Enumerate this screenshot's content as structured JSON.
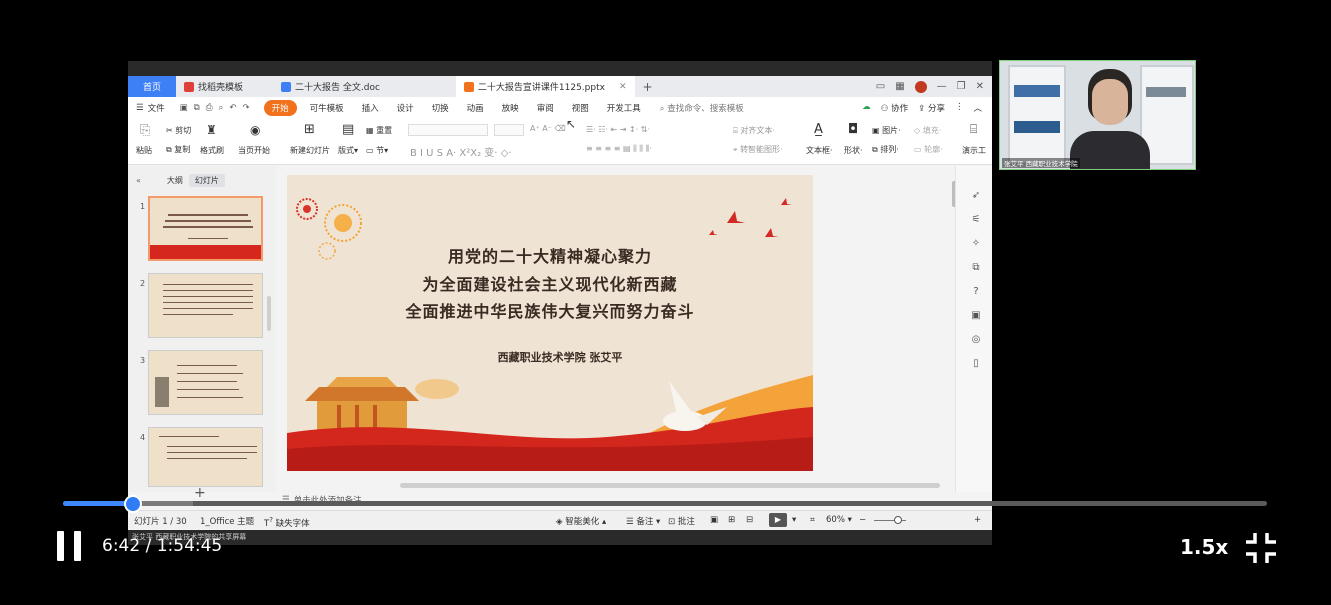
{
  "app": {
    "tabs": [
      {
        "label": "首页"
      },
      {
        "label": "找稻壳模板"
      },
      {
        "label": "二十大报告 全文.doc"
      },
      {
        "label": "二十大报告宣讲课件1125.pptx"
      }
    ],
    "menu": [
      "文件",
      "开始",
      "可牛模板",
      "插入",
      "设计",
      "切换",
      "动画",
      "放映",
      "审阅",
      "视图",
      "开发工具"
    ],
    "search_placeholder": "查找命令、搜索模板",
    "right_actions": [
      "协作",
      "分享"
    ]
  },
  "ribbon": {
    "paste": "粘贴",
    "cut": "剪切",
    "copy": "复制",
    "format_painter": "格式刷",
    "from_current": "当页开始",
    "new_slide": "新建幻灯片",
    "layout": "版式",
    "reset": "重置",
    "section": "节",
    "align_text": "对齐文本",
    "smartart": "转智能图形",
    "textbox": "文本框",
    "shape": "形状",
    "picture": "图片",
    "arrange": "排列",
    "fill": "填充",
    "outline": "轮廓",
    "present": "演示工"
  },
  "left_panel": {
    "tabs": [
      "大纲",
      "幻灯片"
    ],
    "slide_numbers": [
      "1",
      "2",
      "3",
      "4"
    ]
  },
  "slide": {
    "line1": "用党的二十大精神凝心聚力",
    "line2": "为全面建设社会主义现代化新西藏",
    "line3": "全面推进中华民族伟大复兴而努力奋斗",
    "author": "西藏职业技术学院  张艾平"
  },
  "notes_placeholder": "单击此处添加备注",
  "status": {
    "slide_index": "幻灯片 1 / 30",
    "theme": "1_Office 主题",
    "missing_font": "缺失字体",
    "smart_beautify": "智能美化",
    "notes": "备注",
    "comments": "批注",
    "zoom": "60%"
  },
  "bottom_strip": "张艾平 西藏职业技术学院的共享屏幕",
  "webcam": {
    "name": "张艾平 西藏职业技术学院"
  },
  "player": {
    "current_time": "6:42",
    "total_time": "1:54:45",
    "time_display": "6:42 / 1:54:45",
    "speed": "1.5x",
    "progress_fraction": 0.058,
    "accent": "#2f7df6"
  }
}
